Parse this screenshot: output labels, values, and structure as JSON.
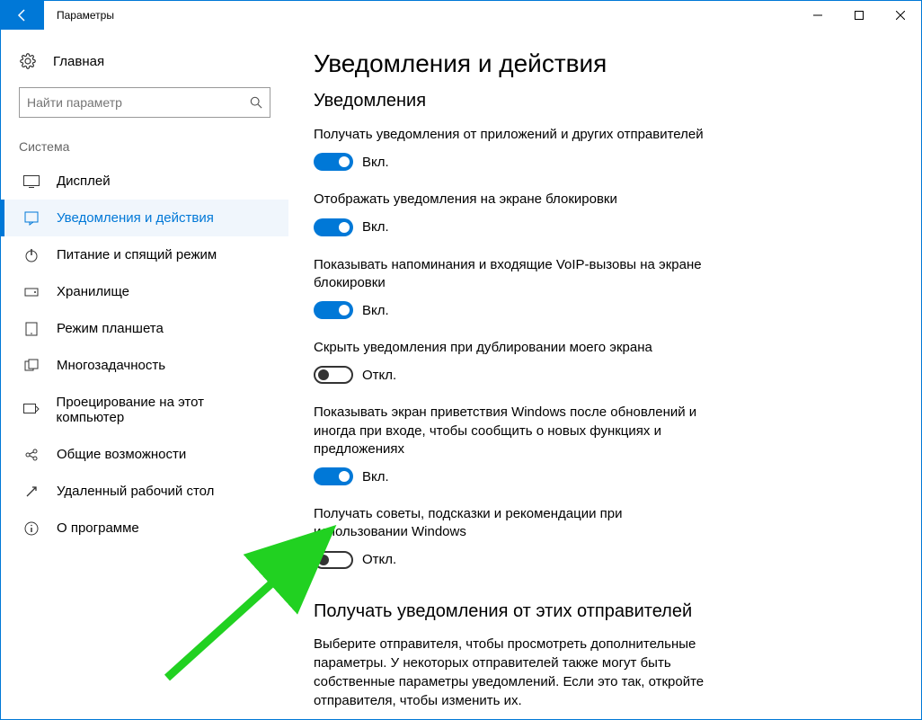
{
  "window": {
    "title": "Параметры"
  },
  "sidebar": {
    "home": "Главная",
    "search_placeholder": "Найти параметр",
    "group": "Система",
    "items": [
      {
        "label": "Дисплей"
      },
      {
        "label": "Уведомления и действия"
      },
      {
        "label": "Питание и спящий режим"
      },
      {
        "label": "Хранилище"
      },
      {
        "label": "Режим планшета"
      },
      {
        "label": "Многозадачность"
      },
      {
        "label": "Проецирование на этот компьютер"
      },
      {
        "label": "Общие возможности"
      },
      {
        "label": "Удаленный рабочий стол"
      },
      {
        "label": "О программе"
      }
    ]
  },
  "main": {
    "title": "Уведомления и действия",
    "section1": "Уведомления",
    "on_label": "Вкл.",
    "off_label": "Откл.",
    "toggles": [
      {
        "label": "Получать уведомления от приложений и других отправителей",
        "on": true
      },
      {
        "label": "Отображать уведомления на экране блокировки",
        "on": true
      },
      {
        "label": "Показывать напоминания и входящие VoIP-вызовы на экране блокировки",
        "on": true
      },
      {
        "label": "Скрыть уведомления при дублировании моего экрана",
        "on": false
      },
      {
        "label": "Показывать экран приветствия Windows после обновлений и иногда при входе, чтобы сообщить о новых функциях и предложениях",
        "on": true
      },
      {
        "label": "Получать советы, подсказки и рекомендации при использовании Windows",
        "on": false
      }
    ],
    "section2": "Получать уведомления от этих отправителей",
    "desc": "Выберите отправителя, чтобы просмотреть дополнительные параметры. У некоторых отправителей также могут быть собственные параметры уведомлений. Если это так, откройте отправителя, чтобы изменить их."
  }
}
